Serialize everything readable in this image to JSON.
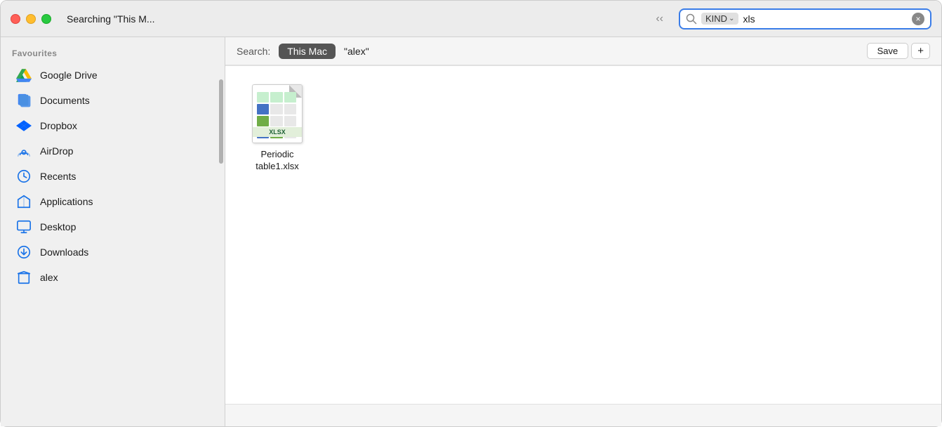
{
  "window": {
    "title": "Searching \"This M...",
    "traffic_lights": {
      "close": "close",
      "minimize": "minimize",
      "maximize": "maximize"
    }
  },
  "search": {
    "kind_label": "KIND",
    "query": "xls",
    "clear_label": "×",
    "label": "Search:",
    "this_mac": "This Mac",
    "alex": "\"alex\"",
    "save_label": "Save",
    "plus_label": "+"
  },
  "sidebar": {
    "section_title": "Favourites",
    "items": [
      {
        "id": "google-drive",
        "label": "Google Drive",
        "icon": "google-drive-icon"
      },
      {
        "id": "documents",
        "label": "Documents",
        "icon": "documents-icon"
      },
      {
        "id": "dropbox",
        "label": "Dropbox",
        "icon": "dropbox-icon"
      },
      {
        "id": "airdrop",
        "label": "AirDrop",
        "icon": "airdrop-icon"
      },
      {
        "id": "recents",
        "label": "Recents",
        "icon": "recents-icon"
      },
      {
        "id": "applications",
        "label": "Applications",
        "icon": "applications-icon"
      },
      {
        "id": "desktop",
        "label": "Desktop",
        "icon": "desktop-icon"
      },
      {
        "id": "downloads",
        "label": "Downloads",
        "icon": "downloads-icon"
      },
      {
        "id": "alex",
        "label": "alex",
        "icon": "alex-icon"
      }
    ]
  },
  "files": [
    {
      "id": "periodic-table",
      "name": "Periodic\ntable1.xlsx",
      "type": "xlsx",
      "label": "XLSX"
    }
  ]
}
